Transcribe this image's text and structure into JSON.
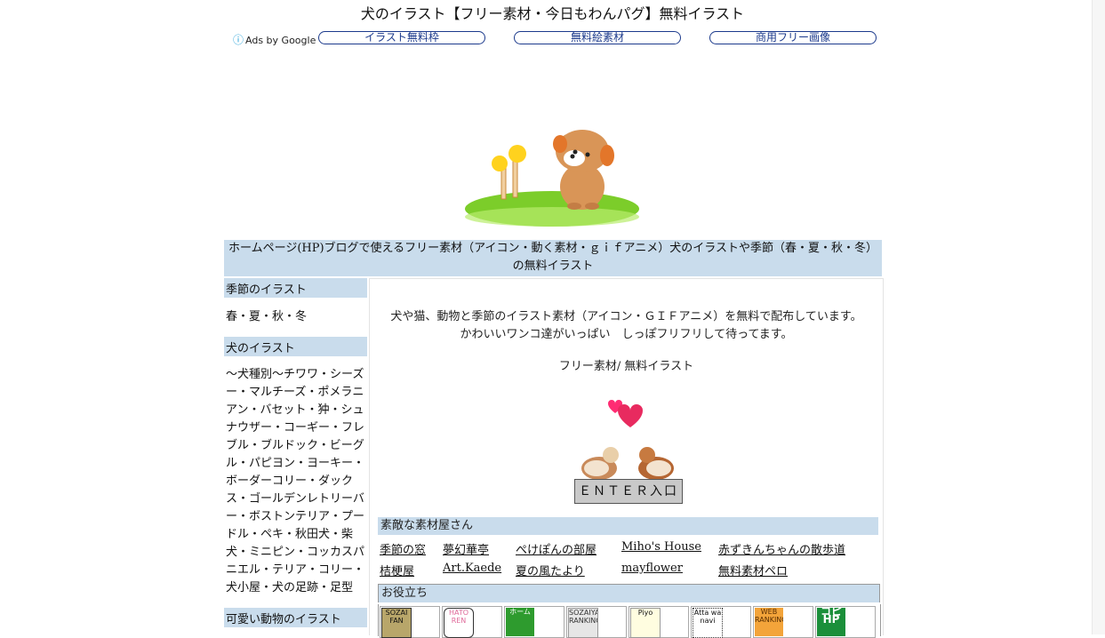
{
  "page": {
    "title": "犬のイラスト【フリー素材・今日もわんパグ】無料イラスト"
  },
  "ads": {
    "label": "Ads by Google",
    "info_icon": "ⓘ",
    "buttons": [
      "イラスト無料枠",
      "無料絵素材",
      "商用フリー画像"
    ]
  },
  "banner": {
    "text": "ホームページ(HP)ブログで使えるフリー素材（アイコン・動く素材・ｇｉｆアニメ）犬のイラストや季節（春・夏・秋・冬）の無料イラスト"
  },
  "sidebar": {
    "sections": [
      {
        "heading": "季節のイラスト",
        "body": "春・夏・秋・冬"
      },
      {
        "heading": "犬のイラスト",
        "body": "〜犬種別〜チワワ・シーズー・マルチーズ・ポメラニアン・バセット・狆・シュナウザー・コーギー・フレブル・ブルドック・ビーグル・パピヨン・ヨーキー・ボーダーコリー・ダックス・ゴールデンレトリーバー・ボストンテリア・プードル・ペキ・秋田犬・柴犬・ミニピン・コッカスパニエル・テリア・コリー・犬小屋・犬の足跡・足型"
      },
      {
        "heading": "可愛い動物のイラスト",
        "body": ""
      }
    ]
  },
  "main": {
    "intro_line1": "犬や猫、動物と季節のイラスト素材（アイコン・ＧＩＦアニメ）を無料で配布しています。",
    "intro_line2": "かわいいワンコ達がいっぱい　しっぽフリフリして待ってます。",
    "free_line": "フリー素材/ 無料イラスト",
    "enter_label": "ＥＮＴＥＲ入口",
    "links_heading": "素敵な素材屋さん",
    "links_row1": [
      "季節の窓",
      "夢幻華亭",
      "ぺけぽんの部屋",
      "Miho's House",
      "赤ずきんちゃんの散歩道"
    ],
    "links_row2": [
      "桔梗屋",
      "Art.Kaede",
      "夏の風たより",
      "mayflower",
      "無料素材ペロ"
    ],
    "useful_heading": "お役立ち",
    "useful_banners": [
      "SOZAI FAN",
      "HATO REN",
      "ホーム",
      "SOZAIYA RANKING",
      "Piyo",
      "Atta wa navi",
      "WEB RANKING",
      "コピHP"
    ]
  },
  "colors": {
    "band": "#c9dcec",
    "ad_border": "#1c3a8c"
  }
}
